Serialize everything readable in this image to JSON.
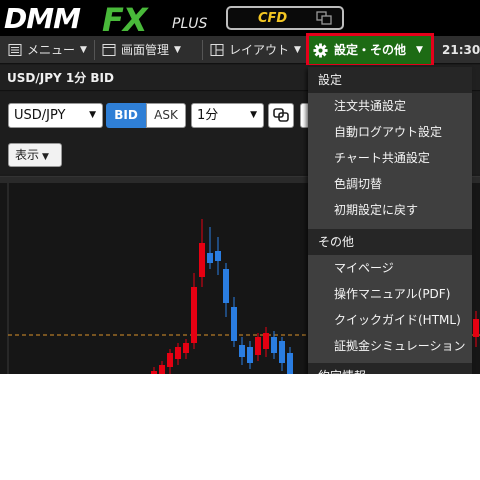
{
  "brand": {
    "logo_main": "DMM",
    "logo_fx": "FX",
    "logo_plus": "PLUS",
    "cfd_label": "CFD",
    "cfd_icon": "window-switch-icon"
  },
  "toolbar": {
    "menu_label": "メニュー",
    "menu_icon": "menu-list-icon",
    "screen_label": "画面管理",
    "screen_icon": "window-icon",
    "layout_label": "レイアウト",
    "layout_icon": "layout-icon",
    "settings_label": "設定・その他",
    "settings_icon": "gear-icon",
    "clock": "21:30",
    "highlight_color": "#e5001b",
    "settings_bg": "#1d6b14"
  },
  "chart_panel": {
    "title": "USD/JPY 1分 BID",
    "pair_value": "USD/JPY",
    "bid_label": "BID",
    "ask_label": "ASK",
    "timeframe_value": "1分",
    "link_icon": "link-windows-icon",
    "show_label": "表示",
    "up_color": "#e60012",
    "down_color": "#2a7de1"
  },
  "settings_menu": {
    "section_settings": "設定",
    "settings_items": [
      "注文共通設定",
      "自動ログアウト設定",
      "チャート共通設定",
      "色調切替",
      "初期設定に戻す"
    ],
    "section_other": "その他",
    "other_items": [
      "マイページ",
      "操作マニュアル(PDF)",
      "クイックガイド(HTML)",
      "証拠金シミュレーション"
    ],
    "section_partial": "約定情報"
  }
}
